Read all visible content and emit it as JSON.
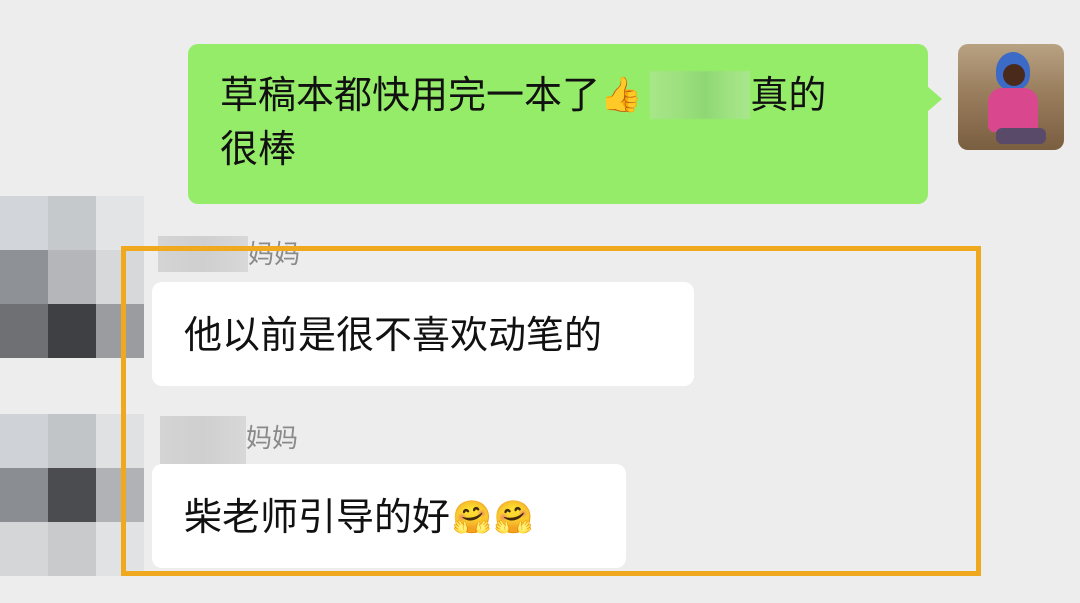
{
  "chat": {
    "messages": [
      {
        "direction": "outgoing",
        "text_line1_a": "草稿本都快用完一本了",
        "emoji_1": "👍",
        "text_line1_b": "真的",
        "text_line2": "很棒"
      },
      {
        "direction": "incoming",
        "sender": "妈妈",
        "text": "他以前是很不喜欢动笔的"
      },
      {
        "direction": "incoming",
        "sender": "妈妈",
        "text": "柴老师引导的好",
        "emojis": [
          "🤗",
          "🤗"
        ]
      }
    ]
  },
  "colors": {
    "background": "#ededed",
    "outgoing_bubble": "#95ec69",
    "incoming_bubble": "#ffffff",
    "highlight_border": "#f0a81e",
    "sender_text": "#8a8a8a"
  },
  "icons": {
    "self_avatar": "avatar-photo-child",
    "incoming_avatar": "avatar-pixelated"
  }
}
